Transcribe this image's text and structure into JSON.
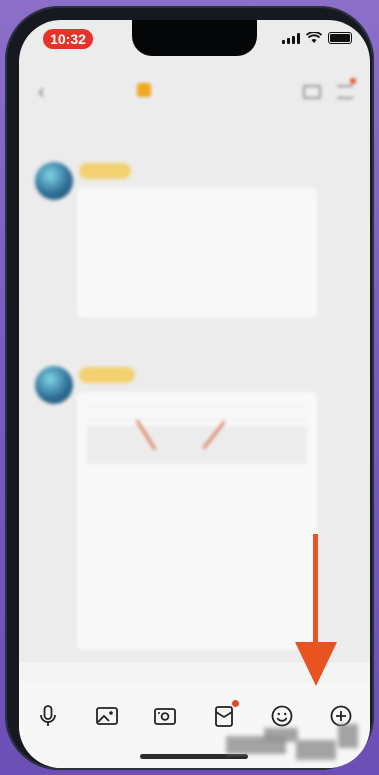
{
  "status": {
    "time": "10:32"
  },
  "nav": {
    "back_icon": "chevron-left-icon",
    "group_title": "",
    "right_icons": [
      "video-icon",
      "menu-icon"
    ],
    "accent": "#e34a2a"
  },
  "chat": {
    "messages": [
      {
        "timestamp": "",
        "badge": "",
        "sender": "",
        "text": ""
      },
      {
        "timestamp": "",
        "badge": "",
        "sender": "",
        "text": "",
        "links": [
          "",
          ""
        ]
      }
    ]
  },
  "toolbar": {
    "items": [
      {
        "icon": "microphone-icon"
      },
      {
        "icon": "image-icon"
      },
      {
        "icon": "camera-icon"
      },
      {
        "icon": "red-packet-icon",
        "has_badge": true
      },
      {
        "icon": "emoji-icon"
      },
      {
        "icon": "plus-icon"
      }
    ]
  },
  "colors": {
    "time_pill": "#e5332a",
    "annotation_arrow": "#e8531f",
    "background": "#7a5cbf"
  }
}
